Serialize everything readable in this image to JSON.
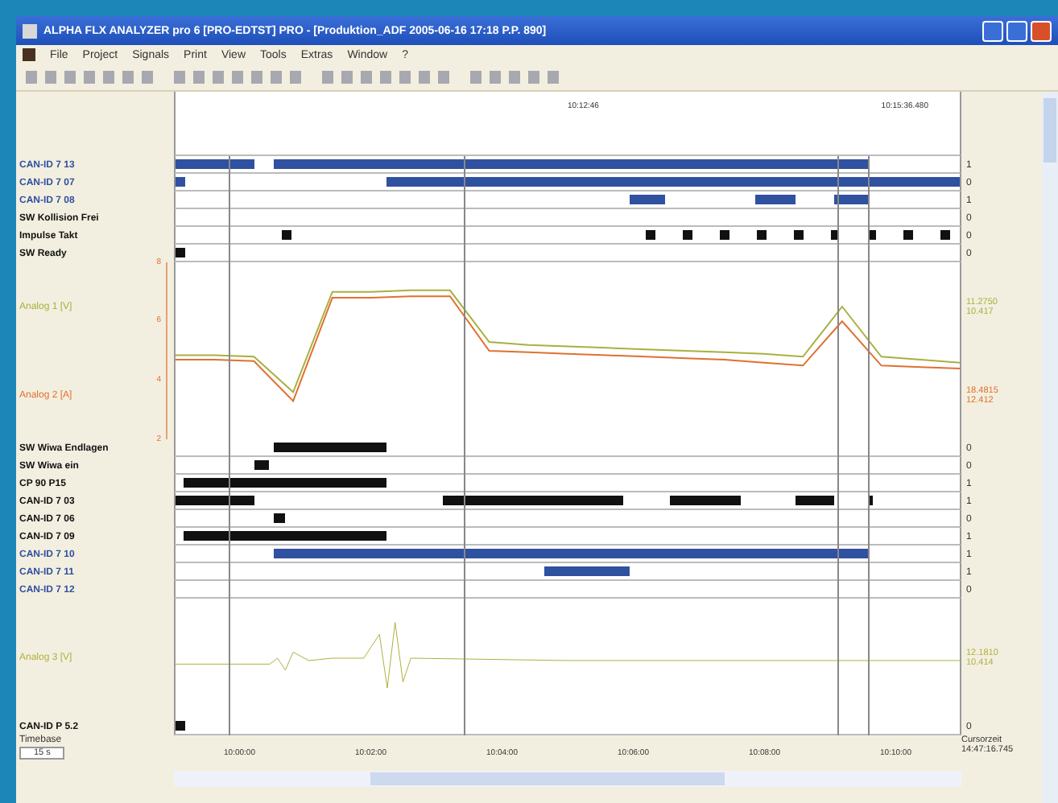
{
  "window": {
    "title": "ALPHA FLX ANALYZER pro 6 [PRO-EDTST] PRO - [Produktion_ADF 2005-06-16 17:18 P.P. 890]"
  },
  "menu": [
    "File",
    "Project",
    "Signals",
    "Print",
    "View",
    "Tools",
    "Extras",
    "Window",
    "?"
  ],
  "ruler": {
    "markers": [
      "10:12:46",
      "10:15:36.480"
    ]
  },
  "group_1": [
    {
      "label": "CAN-ID 7 13",
      "color": "#3050a0",
      "value": "1"
    },
    {
      "label": "CAN-ID 7 07",
      "color": "#3050a0",
      "value": "0"
    },
    {
      "label": "CAN-ID 7 08",
      "color": "#3050a0",
      "value": "1"
    },
    {
      "label": "SW Kollision Frei",
      "color": "#111111",
      "value": "0"
    },
    {
      "label": "Impulse Takt",
      "color": "#111111",
      "value": "0"
    },
    {
      "label": "SW Ready",
      "color": "#111111",
      "value": "0"
    }
  ],
  "analog_1": {
    "chart_data": {
      "type": "line",
      "ylim": [
        2,
        8
      ],
      "yticks": [
        8,
        6,
        4,
        2
      ],
      "series": [
        {
          "name": "Analog 1 [V]",
          "color": "#a8b040",
          "values": [
            4.85,
            4.85,
            4.8,
            3.6,
            7.0,
            7.0,
            7.05,
            7.05,
            5.3,
            5.2,
            5.15,
            5.1,
            5.05,
            5.0,
            4.95,
            4.9,
            4.8,
            6.5,
            4.8,
            4.7,
            4.6
          ]
        },
        {
          "name": "Analog 2 [A]",
          "color": "#e07030",
          "values": [
            4.7,
            4.7,
            4.65,
            3.3,
            6.8,
            6.8,
            6.85,
            6.85,
            5.0,
            4.95,
            4.9,
            4.85,
            4.8,
            4.75,
            4.7,
            4.6,
            4.5,
            6.0,
            4.5,
            4.45,
            4.4
          ]
        }
      ]
    },
    "readings": [
      {
        "reading": "11.2750",
        "unit": "10.417"
      },
      {
        "reading": "18.4815",
        "unit": "12.412"
      }
    ]
  },
  "group_2": [
    {
      "label": "SW Wiwa Endlagen",
      "color": "#111111",
      "value": "0"
    },
    {
      "label": "SW Wiwa ein",
      "color": "#111111",
      "value": "0"
    },
    {
      "label": "CP 90 P15",
      "color": "#111111",
      "value": "1"
    },
    {
      "label": "CAN-ID 7 03",
      "color": "#111111",
      "value": "1"
    },
    {
      "label": "CAN-ID 7 06",
      "color": "#111111",
      "value": "0"
    },
    {
      "label": "CAN-ID 7 09",
      "color": "#111111",
      "value": "1"
    },
    {
      "label": "CAN-ID 7 10",
      "color": "#3050a0",
      "value": "1"
    },
    {
      "label": "CAN-ID 7 11",
      "color": "#3050a0",
      "value": "1"
    },
    {
      "label": "CAN-ID 7 12",
      "color": "#3050a0",
      "value": "0"
    }
  ],
  "analog_2": {
    "traces": [
      {
        "label": "Analog 3 [V]",
        "color": "#b0b040",
        "reading": "12.1810",
        "unit": "10.414"
      }
    ]
  },
  "group_3": [
    {
      "label": "CAN-ID P 5.2",
      "color": "#111111",
      "value": "0"
    }
  ],
  "time_axis": [
    "10:00:00",
    "10:02:00",
    "10:04:00",
    "10:06:00",
    "10:08:00",
    "10:10:00"
  ],
  "timebase": {
    "label": "Timebase",
    "value": "15 s"
  },
  "cursor": {
    "label": "Cursorzeit",
    "value": "14:47:16.745"
  }
}
